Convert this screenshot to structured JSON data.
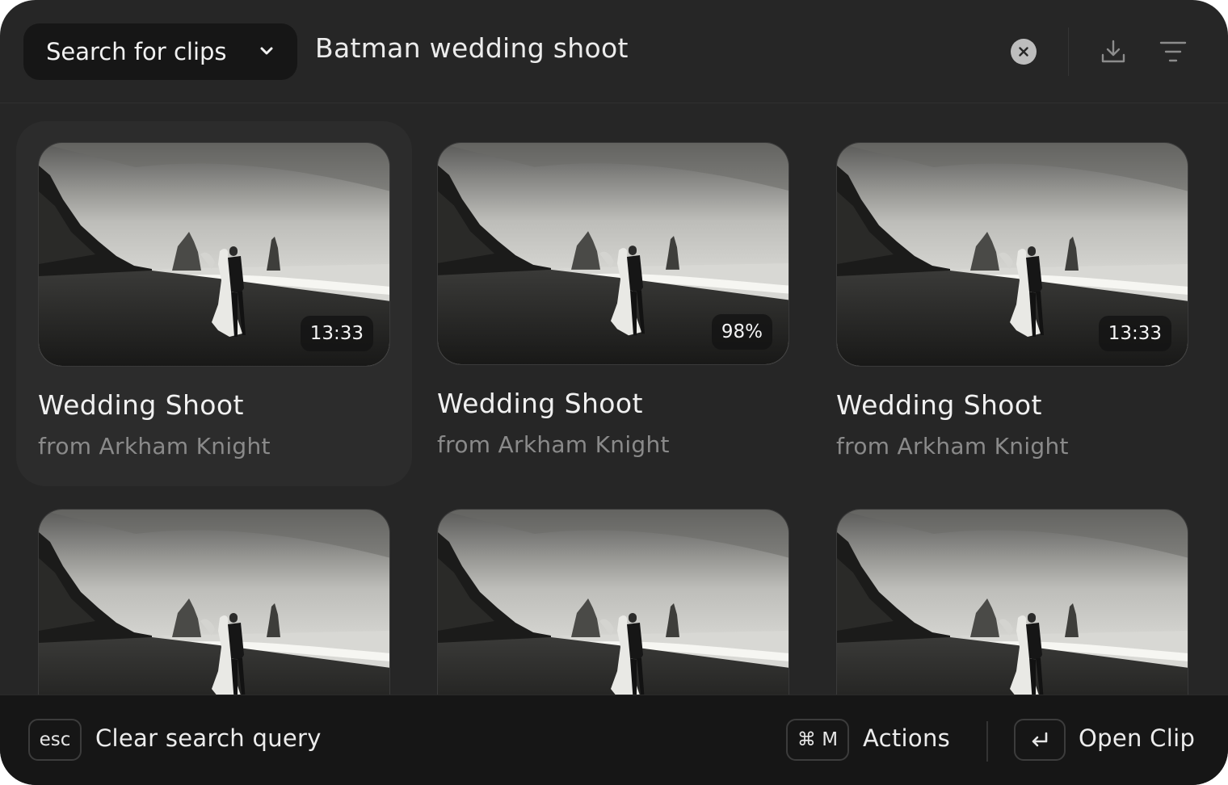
{
  "search": {
    "scope_label": "Search for clips",
    "query": "Batman wedding shoot"
  },
  "icons": {
    "scope": "chevron-down-icon",
    "clear": "close-circle-icon",
    "download": "download-icon",
    "filter": "filter-lines-icon",
    "enter": "return-arrow-icon"
  },
  "clips": [
    {
      "title": "Wedding Shoot",
      "source": "from Arkham Knight",
      "badge": "13:33"
    },
    {
      "title": "Wedding Shoot",
      "source": "from Arkham Knight",
      "badge": "98%"
    },
    {
      "title": "Wedding Shoot",
      "source": "from Arkham Knight",
      "badge": "13:33"
    },
    {
      "title": "",
      "source": "",
      "badge": ""
    },
    {
      "title": "",
      "source": "",
      "badge": ""
    },
    {
      "title": "",
      "source": "",
      "badge": ""
    }
  ],
  "footer": {
    "clear_key": "esc",
    "clear_label": "Clear search query",
    "actions_key": "⌘ M",
    "actions_label": "Actions",
    "open_label": "Open Clip"
  },
  "colors": {
    "window_bg": "#262626",
    "bar_bg": "#161616",
    "text_primary": "#f0f0f0",
    "text_secondary": "#8a8a8a"
  }
}
